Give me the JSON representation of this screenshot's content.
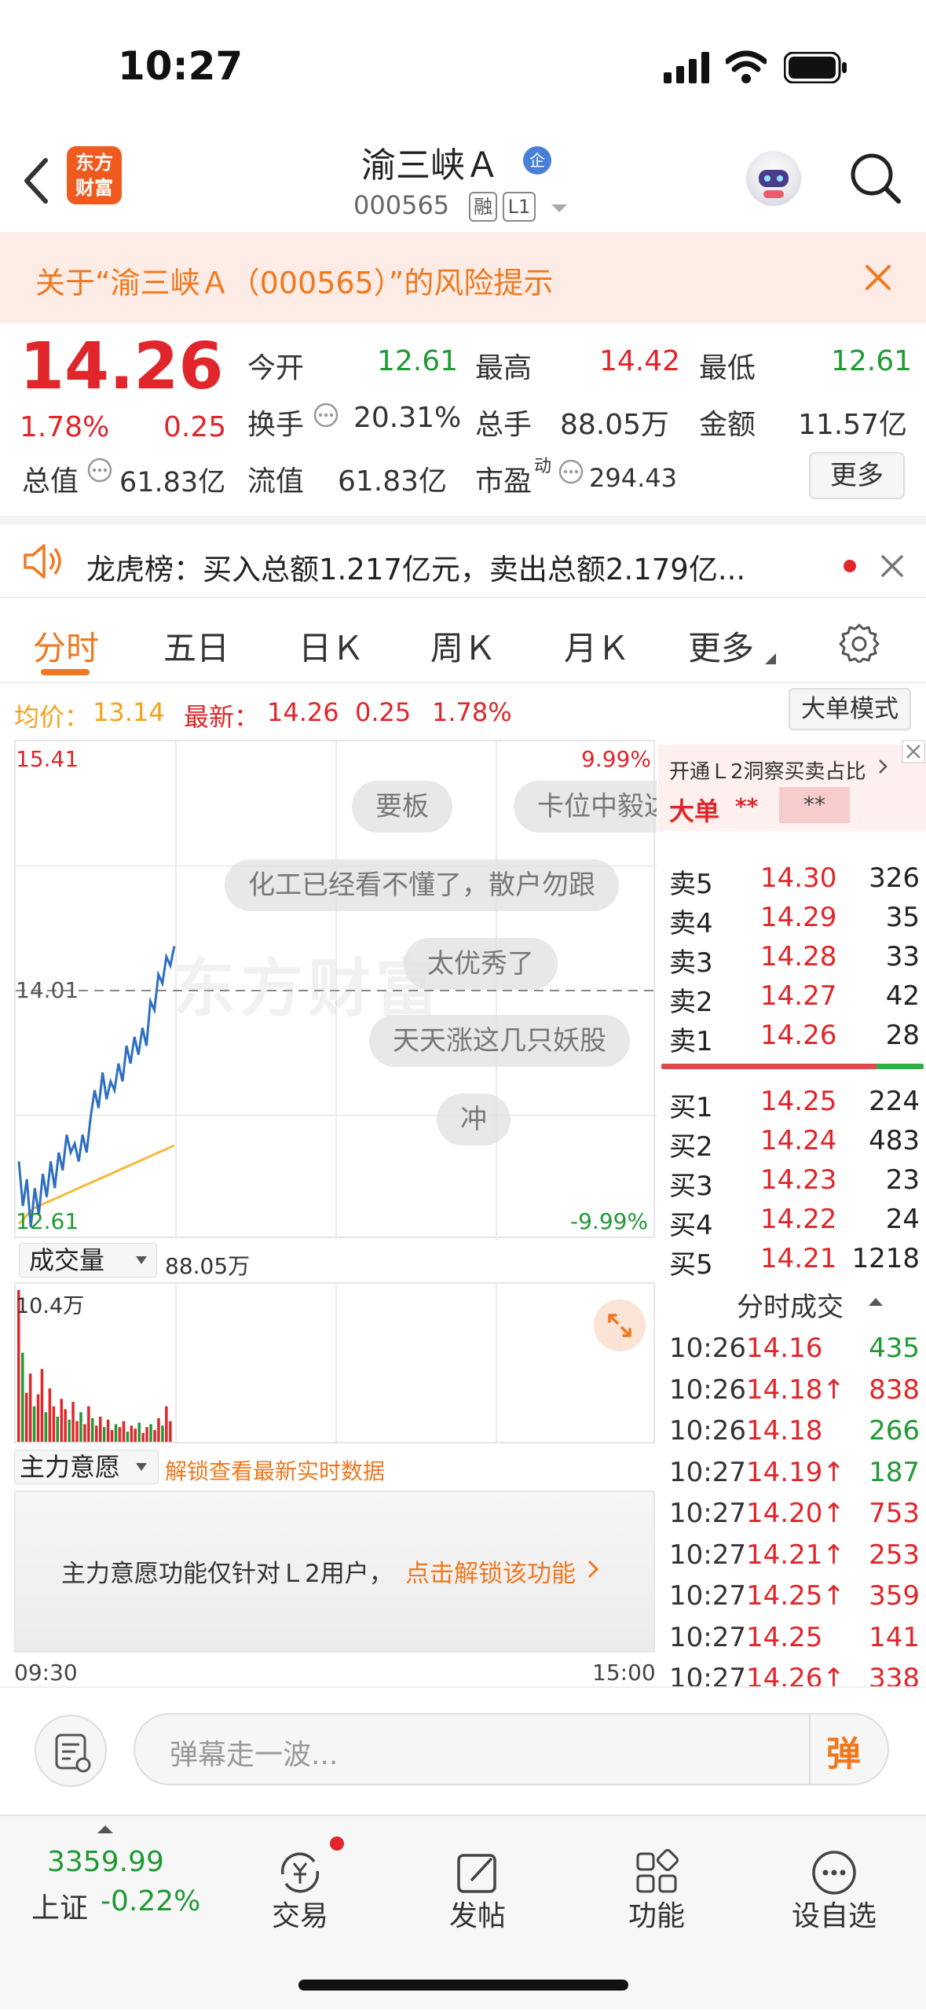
{
  "status": {
    "time": "10:27"
  },
  "nav": {
    "logo_line1": "东方",
    "logo_line2": "财富",
    "stock_name": "渝三峡Ａ",
    "badge": "企",
    "code": "000565",
    "tag1": "融",
    "tag2": "L1"
  },
  "risk": {
    "text": "关于“渝三峡Ａ（000565）”的风险提示"
  },
  "quote": {
    "price": "14.26",
    "pct": "1.78%",
    "chg": "0.25",
    "open_label": "今开",
    "open": "12.61",
    "high_label": "最高",
    "high": "14.42",
    "low_label": "最低",
    "low": "12.61",
    "turnover_label": "换手",
    "turnover": "20.31%",
    "vol_label": "总手",
    "vol": "88.05万",
    "amount_label": "金额",
    "amount": "11.57亿",
    "mcap_label": "总值",
    "mcap": "61.83亿",
    "float_label": "流值",
    "float": "61.83亿",
    "pe_label": "市盈",
    "pe_sup": "动",
    "pe": "294.43",
    "more": "更多"
  },
  "dragon": {
    "text": "龙虎榜：买入总额1.217亿元，卖出总额2.179亿..."
  },
  "tabs": [
    "分时",
    "五日",
    "日Ｋ",
    "周Ｋ",
    "月Ｋ",
    "更多"
  ],
  "avgline": {
    "avg_label": "均价：",
    "avg": "13.14",
    "last_label": "最新：",
    "last": "14.26",
    "chg": "0.25",
    "pct": "1.78%",
    "mode_btn": "大单模式"
  },
  "chart": {
    "y_top": "15.41",
    "y_mid": "14.01",
    "y_bot": "12.61",
    "pct_top": "9.99%",
    "pct_bot": "-9.99%",
    "watermark": "东方财富",
    "danmu": [
      "要板",
      "卡位中毅达",
      "化工已经看不懂了，散户勿跟",
      "太优秀了",
      "天天涨这几只妖股",
      "冲"
    ],
    "colors": {
      "price": "#2e6fc0",
      "avg": "#f2b93b",
      "up": "#e0262a",
      "down": "#1f9a35"
    }
  },
  "chart_data": {
    "type": "line",
    "ylim": [
      12.61,
      15.41
    ],
    "x_range": [
      "09:30",
      "15:00"
    ],
    "price": [
      13.05,
      12.8,
      12.95,
      12.68,
      12.9,
      12.75,
      12.98,
      12.85,
      13.05,
      12.9,
      13.1,
      13.0,
      13.2,
      13.1,
      13.15,
      13.05,
      13.2,
      13.1,
      13.3,
      13.45,
      13.35,
      13.55,
      13.4,
      13.5,
      13.45,
      13.6,
      13.5,
      13.7,
      13.6,
      13.75,
      13.65,
      13.8,
      13.7,
      13.95,
      13.9,
      14.1,
      14.05,
      14.2,
      14.15,
      14.26
    ],
    "avg": [
      12.7,
      12.72,
      12.75,
      12.77,
      12.79,
      12.8,
      12.81,
      12.82,
      12.83,
      12.84,
      12.85,
      12.86,
      12.87,
      12.88,
      12.89,
      12.9,
      12.91,
      12.92,
      12.93,
      12.94,
      12.95,
      12.96,
      12.97,
      12.98,
      12.99,
      13.0,
      13.01,
      13.02,
      13.03,
      13.04,
      13.05,
      13.06,
      13.07,
      13.08,
      13.09,
      13.1,
      13.11,
      13.12,
      13.13,
      13.14
    ]
  },
  "volume": {
    "label": "成交量",
    "total": "88.05万",
    "max": "10.4万"
  },
  "volume_data": [
    10.4,
    6.2,
    3.5,
    4.8,
    2.6,
    3.4,
    5.1,
    2.2,
    3.8,
    2.6,
    1.9,
    3.1,
    2.4,
    1.7,
    2.9,
    1.6,
    2.2,
    1.4,
    2.6,
    1.8,
    1.3,
    1.9,
    1.2,
    1.7,
    1.0,
    1.4,
    1.2,
    1.6,
    0.9,
    1.3,
    1.1,
    1.5,
    0.8,
    1.2,
    1.4,
    1.0,
    1.8,
    1.3,
    2.6,
    1.6
  ],
  "intent": {
    "label": "主力意愿",
    "unlock": "解锁查看最新实时数据",
    "note": "主力意愿功能仅针对Ｌ2用户，",
    "note_link": "点击解锁该功能"
  },
  "times": {
    "start": "09:30",
    "end": "15:00"
  },
  "book": {
    "promo": "开通Ｌ2洞察买卖占比",
    "big_label": "大单",
    "big_val1": "**",
    "big_val2": "**",
    "sells": [
      {
        "label": "卖5",
        "price": "14.30",
        "qty": "326"
      },
      {
        "label": "卖4",
        "price": "14.29",
        "qty": "35"
      },
      {
        "label": "卖3",
        "price": "14.28",
        "qty": "33"
      },
      {
        "label": "卖2",
        "price": "14.27",
        "qty": "42"
      },
      {
        "label": "卖1",
        "price": "14.26",
        "qty": "28"
      }
    ],
    "buys": [
      {
        "label": "买1",
        "price": "14.25",
        "qty": "224"
      },
      {
        "label": "买2",
        "price": "14.24",
        "qty": "483"
      },
      {
        "label": "买3",
        "price": "14.23",
        "qty": "23"
      },
      {
        "label": "买4",
        "price": "14.22",
        "qty": "24"
      },
      {
        "label": "买5",
        "price": "14.21",
        "qty": "1218"
      }
    ],
    "ticks_label": "分时成交",
    "ticks": [
      {
        "t": "10:26",
        "p": "14.16",
        "q": "435",
        "c": "green"
      },
      {
        "t": "10:26",
        "p": "14.18↑",
        "q": "838",
        "c": "red"
      },
      {
        "t": "10:26",
        "p": "14.18",
        "q": "266",
        "c": "green"
      },
      {
        "t": "10:27",
        "p": "14.19↑",
        "q": "187",
        "c": "green"
      },
      {
        "t": "10:27",
        "p": "14.20↑",
        "q": "753",
        "c": "red"
      },
      {
        "t": "10:27",
        "p": "14.21↑",
        "q": "253",
        "c": "red"
      },
      {
        "t": "10:27",
        "p": "14.25↑",
        "q": "359",
        "c": "red"
      },
      {
        "t": "10:27",
        "p": "14.25",
        "q": "141",
        "c": "red"
      },
      {
        "t": "10:27",
        "p": "14.26↑",
        "q": "338",
        "c": "red"
      }
    ]
  },
  "danmu_bar": {
    "placeholder": "弹幕走一波...",
    "send": "弹"
  },
  "bottom": {
    "index_val": "3359.99",
    "index_name": "上证",
    "index_pct": "-0.22%",
    "trade": "交易",
    "post": "发帖",
    "func": "功能",
    "watch": "设自选"
  }
}
